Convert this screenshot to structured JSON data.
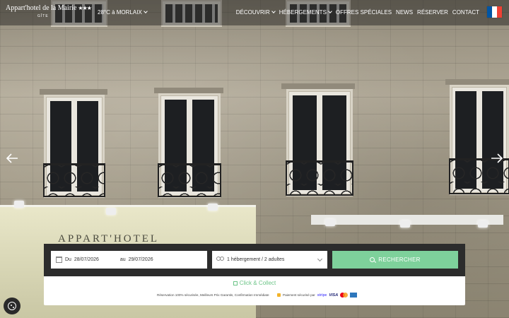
{
  "header": {
    "brand_name": "Appart'hotel de la Mairie",
    "brand_stars": "★★★",
    "brand_subtitle": "GÎTE",
    "weather": "28°C à MORLAIX",
    "nav": [
      {
        "label": "DÉCOUVRIR",
        "dropdown": true
      },
      {
        "label": "HÉBERGEMENTS",
        "dropdown": true
      },
      {
        "label": "OFFRES SPÉCIALES",
        "dropdown": false
      },
      {
        "label": "NEWS",
        "dropdown": false
      },
      {
        "label": "RÉSERVER",
        "dropdown": false
      },
      {
        "label": "CONTACT",
        "dropdown": false
      }
    ],
    "language_flag": {
      "icon": "french-flag-icon",
      "colors": [
        "#0055A4",
        "#FFFFFF",
        "#EF4135"
      ]
    }
  },
  "hero": {
    "shop_sign": "APPART'HOTEL",
    "prev_icon": "arrow-left-icon",
    "next_icon": "arrow-right-icon"
  },
  "booking": {
    "from_prefix": "Du",
    "from_date": "28/07/2026",
    "to_prefix": "au",
    "to_date": "29/07/2026",
    "guests": "1 hébergement / 2 adultes",
    "search_label": "RECHERCHER",
    "click_collect": "Click & Collect",
    "assurance": "Réservation 100% sécurisée, Meilleurs Prix Garantis, Confirmation Immédiate",
    "secure_payment": "Paiement sécurisé par",
    "stripe": "stripe",
    "visa": "VISA",
    "accent_color": "#7ED19B"
  },
  "cookie": {
    "icon": "cookie-settings-icon"
  }
}
